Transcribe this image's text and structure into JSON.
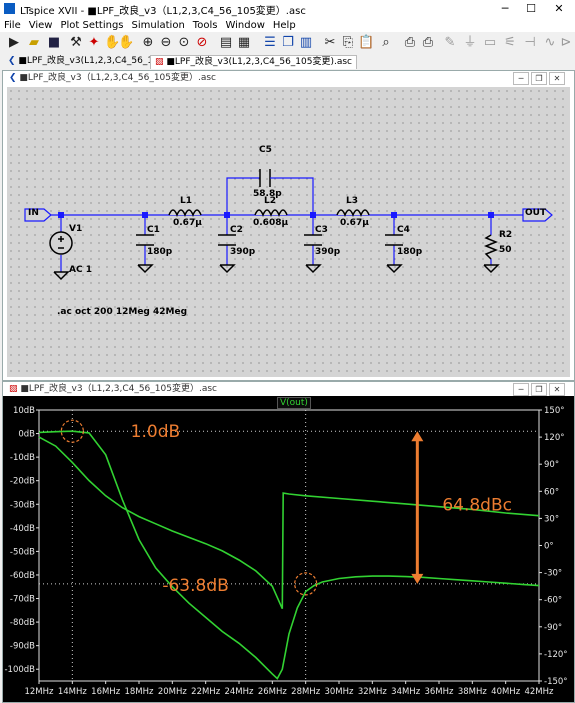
{
  "window": {
    "title": "LTspice XVII - ■LPF_改良_v3（L1,2,3,C4_56_105変更）.asc",
    "minimize": "─",
    "maximize": "☐",
    "close": "✕"
  },
  "menu": [
    "File",
    "View",
    "Plot Settings",
    "Simulation",
    "Tools",
    "Window",
    "Help"
  ],
  "tabs": [
    {
      "label": "■LPF_改良_v3(L1,2,3,C4_56_105変更).asc"
    },
    {
      "label": "■LPF_改良_v3(L1,2,3,C4_56_105変更).asc"
    }
  ],
  "schematic": {
    "window_title": "■LPF_改良_v3（L1,2,3,C4_56_105変更）.asc",
    "in_label": "IN",
    "out_label": "OUT",
    "v1": {
      "name": "V1",
      "value": "AC 1"
    },
    "c1": {
      "name": "C1",
      "value": "180p"
    },
    "c2": {
      "name": "C2",
      "value": "390p"
    },
    "c3": {
      "name": "C3",
      "value": "390p"
    },
    "c4": {
      "name": "C4",
      "value": "180p"
    },
    "c5": {
      "name": "C5",
      "value": "58.8p"
    },
    "l1": {
      "name": "L1",
      "value": "0.67μ"
    },
    "l2": {
      "name": "L2",
      "value": "0.608μ"
    },
    "l3": {
      "name": "L3",
      "value": "0.67μ"
    },
    "r2": {
      "name": "R2",
      "value": "50"
    },
    "directive": ".ac oct 200 12Meg 42Meg"
  },
  "plot": {
    "window_title": "■LPF_改良_v3（L1,2,3,C4_56_105変更）.asc",
    "trace_label": "V(out)",
    "y_left_ticks": [
      "10dB",
      "0dB",
      "-10dB",
      "-20dB",
      "-30dB",
      "-40dB",
      "-50dB",
      "-60dB",
      "-70dB",
      "-80dB",
      "-90dB",
      "-100dB"
    ],
    "y_right_ticks": [
      "150°",
      "120°",
      "90°",
      "60°",
      "30°",
      "0°",
      "-30°",
      "-60°",
      "-90°",
      "-120°",
      "-150°"
    ],
    "x_ticks": [
      "12MHz",
      "14MHz",
      "16MHz",
      "18MHz",
      "20MHz",
      "22MHz",
      "24MHz",
      "26MHz",
      "28MHz",
      "30MHz",
      "32MHz",
      "34MHz",
      "36MHz",
      "38MHz",
      "40MHz",
      "42MHz"
    ],
    "annotations": {
      "ripple": "1.0dB",
      "stopband": "-63.8dB",
      "rejection": "64.8dBc"
    },
    "colors": {
      "trace": "#32d232",
      "annotation": "#ed7d31",
      "grid": "#cfcfcf"
    }
  },
  "chart_data": {
    "type": "line",
    "xlabel": "",
    "ylabel": "",
    "x_unit": "MHz",
    "xlim": [
      12,
      42
    ],
    "ylim": [
      -105,
      10
    ],
    "ylim_right": [
      -150,
      150
    ],
    "series": [
      {
        "name": "V(out)",
        "axis": "magnitude_dB",
        "x": [
          12,
          13,
          14,
          15,
          16,
          17,
          18,
          19,
          20,
          21,
          22,
          23,
          24,
          25,
          26,
          26.3,
          26.6,
          27,
          27.5,
          28,
          28.5,
          29,
          30,
          31,
          32,
          33,
          34,
          35,
          36,
          37,
          38,
          39,
          40,
          41,
          42
        ],
        "y": [
          0.5,
          0.8,
          1.0,
          0.3,
          -9,
          -28,
          -45,
          -57,
          -65,
          -72,
          -78,
          -84,
          -89,
          -95,
          -102,
          -104,
          -100,
          -85,
          -74,
          -67,
          -64.5,
          -63,
          -61.5,
          -60.8,
          -60.5,
          -60.5,
          -60.7,
          -61,
          -61.5,
          -62,
          -62.5,
          -63,
          -63.5,
          -64,
          -64.5
        ]
      },
      {
        "name": "V(out)",
        "axis": "phase_deg",
        "x": [
          12,
          13,
          14,
          15,
          16,
          17,
          18,
          19,
          20,
          21,
          22,
          23,
          24,
          25,
          26,
          26.6,
          26.65,
          27,
          28,
          30,
          32,
          34,
          36,
          38,
          40,
          42
        ],
        "y": [
          120,
          110,
          92,
          72,
          55,
          42,
          32,
          24,
          16,
          9,
          2,
          -6,
          -16,
          -28,
          -45,
          -70,
          58,
          57,
          55,
          52,
          49,
          46,
          43,
          40,
          36,
          33
        ]
      }
    ]
  }
}
